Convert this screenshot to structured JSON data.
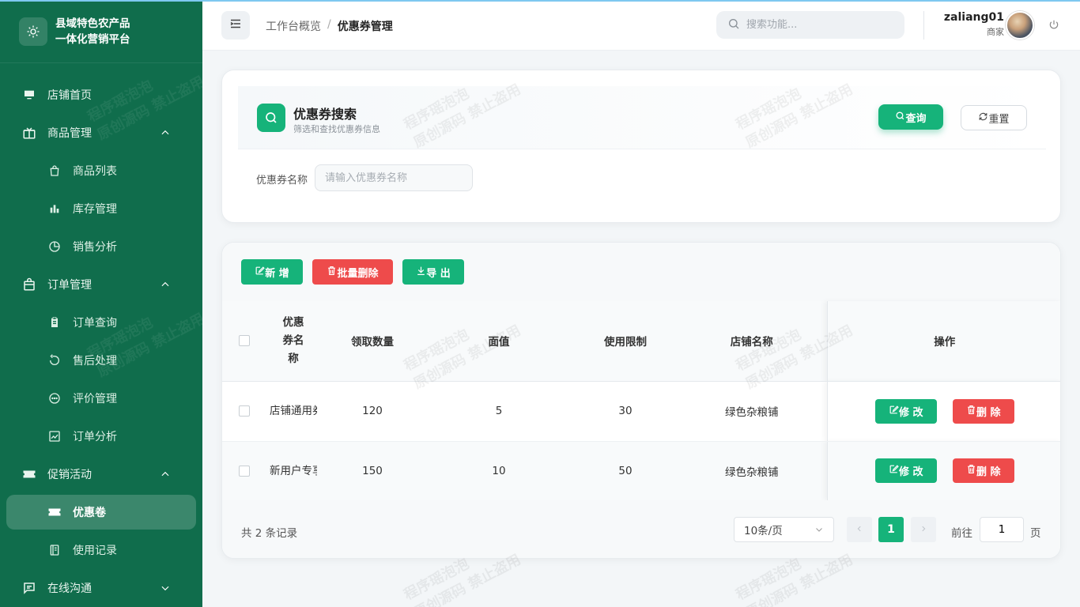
{
  "app": {
    "title_line1": "县域特色农产品",
    "title_line2": "一体化营销平台"
  },
  "sidebar": {
    "items": [
      {
        "label": "店铺首页",
        "icon": "store-icon",
        "type": "top"
      },
      {
        "label": "商品管理",
        "icon": "gift-box-icon",
        "type": "group",
        "expanded": true
      },
      {
        "label": "商品列表",
        "icon": "shopping-bag-icon",
        "type": "sub"
      },
      {
        "label": "库存管理",
        "icon": "bar-chart-icon",
        "type": "sub"
      },
      {
        "label": "销售分析",
        "icon": "pie-chart-icon",
        "type": "sub"
      },
      {
        "label": "订单管理",
        "icon": "bag-icon",
        "type": "group",
        "expanded": true
      },
      {
        "label": "订单查询",
        "icon": "clipboard-icon",
        "type": "sub"
      },
      {
        "label": "售后处理",
        "icon": "refresh-icon",
        "type": "sub"
      },
      {
        "label": "评价管理",
        "icon": "chat-bubble-icon",
        "type": "sub"
      },
      {
        "label": "订单分析",
        "icon": "trend-chart-icon",
        "type": "sub"
      },
      {
        "label": "促销活动",
        "icon": "ticket-icon",
        "type": "group",
        "expanded": true
      },
      {
        "label": "优惠卷",
        "icon": "ticket-icon",
        "type": "sub",
        "active": true
      },
      {
        "label": "使用记录",
        "icon": "notebook-icon",
        "type": "sub"
      },
      {
        "label": "在线沟通",
        "icon": "message-icon",
        "type": "group",
        "expanded": false
      }
    ]
  },
  "header": {
    "breadcrumb": [
      "工作台概览",
      "优惠券管理"
    ],
    "breadcrumb_sep": "/",
    "search_placeholder": "搜索功能...",
    "username": "zaliang01",
    "role": "商家"
  },
  "search_card": {
    "title": "优惠券搜索",
    "subtitle": "筛选和查找优惠券信息",
    "query_label": "查询",
    "reset_label": "重置",
    "field_label": "优惠券名称",
    "field_placeholder": "请输入优惠券名称"
  },
  "toolbar": {
    "add_label": "新 增",
    "batch_delete_label": "批量删除",
    "export_label": "导 出"
  },
  "table": {
    "headers": [
      "优惠券名称",
      "领取数量",
      "面值",
      "使用限制",
      "店铺名称",
      "操作"
    ],
    "rows": [
      {
        "name": "店铺通用券",
        "quantity": "120",
        "value": "5",
        "limit": "30",
        "shop": "绿色杂粮铺"
      },
      {
        "name": "新用户专享",
        "quantity": "150",
        "value": "10",
        "limit": "50",
        "shop": "绿色杂粮铺"
      }
    ],
    "edit_label": "修 改",
    "delete_label": "删 除"
  },
  "pagination": {
    "total_text": "共 2 条记录",
    "page_size": "10条/页",
    "current_page": "1",
    "goto_label": "前往",
    "goto_value": "1",
    "page_unit": "页"
  },
  "colors": {
    "sidebar_bg": "#106d4c",
    "primary": "#16b37a",
    "danger": "#ee4b4b"
  }
}
